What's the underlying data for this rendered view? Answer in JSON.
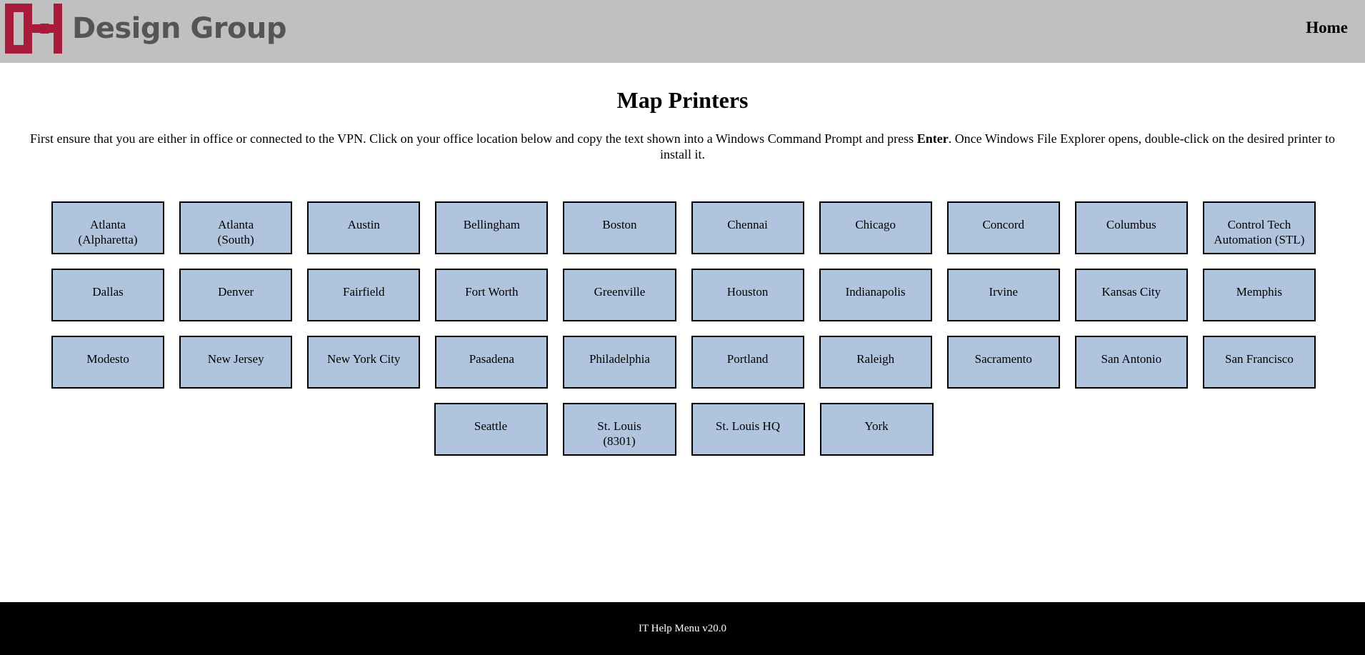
{
  "header": {
    "brand_name": "Design Group",
    "logo_icon": "dg-logo-icon",
    "logo_color": "#a71c3a",
    "home_label": "Home"
  },
  "main": {
    "title": "Map Printers",
    "instructions_before": "First ensure that you are either in office or connected to the VPN. Click on your office location below and copy the text shown into a Windows Command Prompt and press ",
    "instructions_bold": "Enter",
    "instructions_after": ". Once Windows File Explorer opens, double-click on the desired printer to install it.",
    "locations": [
      [
        "Atlanta\n(Alpharetta)",
        "Atlanta\n(South)",
        "Austin",
        "Bellingham",
        "Boston",
        "Chennai",
        "Chicago",
        "Concord",
        "Columbus",
        "Control Tech\nAutomation (STL)"
      ],
      [
        "Dallas",
        "Denver",
        "Fairfield",
        "Fort Worth",
        "Greenville",
        "Houston",
        "Indianapolis",
        "Irvine",
        "Kansas City",
        "Memphis"
      ],
      [
        "Modesto",
        "New Jersey",
        "New York City",
        "Pasadena",
        "Philadelphia",
        "Portland",
        "Raleigh",
        "Sacramento",
        "San Antonio",
        "San Francisco"
      ],
      [
        "Seattle",
        "St. Louis\n(8301)",
        "St. Louis HQ",
        "York"
      ]
    ],
    "tile_color": "#b0c4de"
  },
  "footer": {
    "text": "IT Help Menu v20.0"
  }
}
